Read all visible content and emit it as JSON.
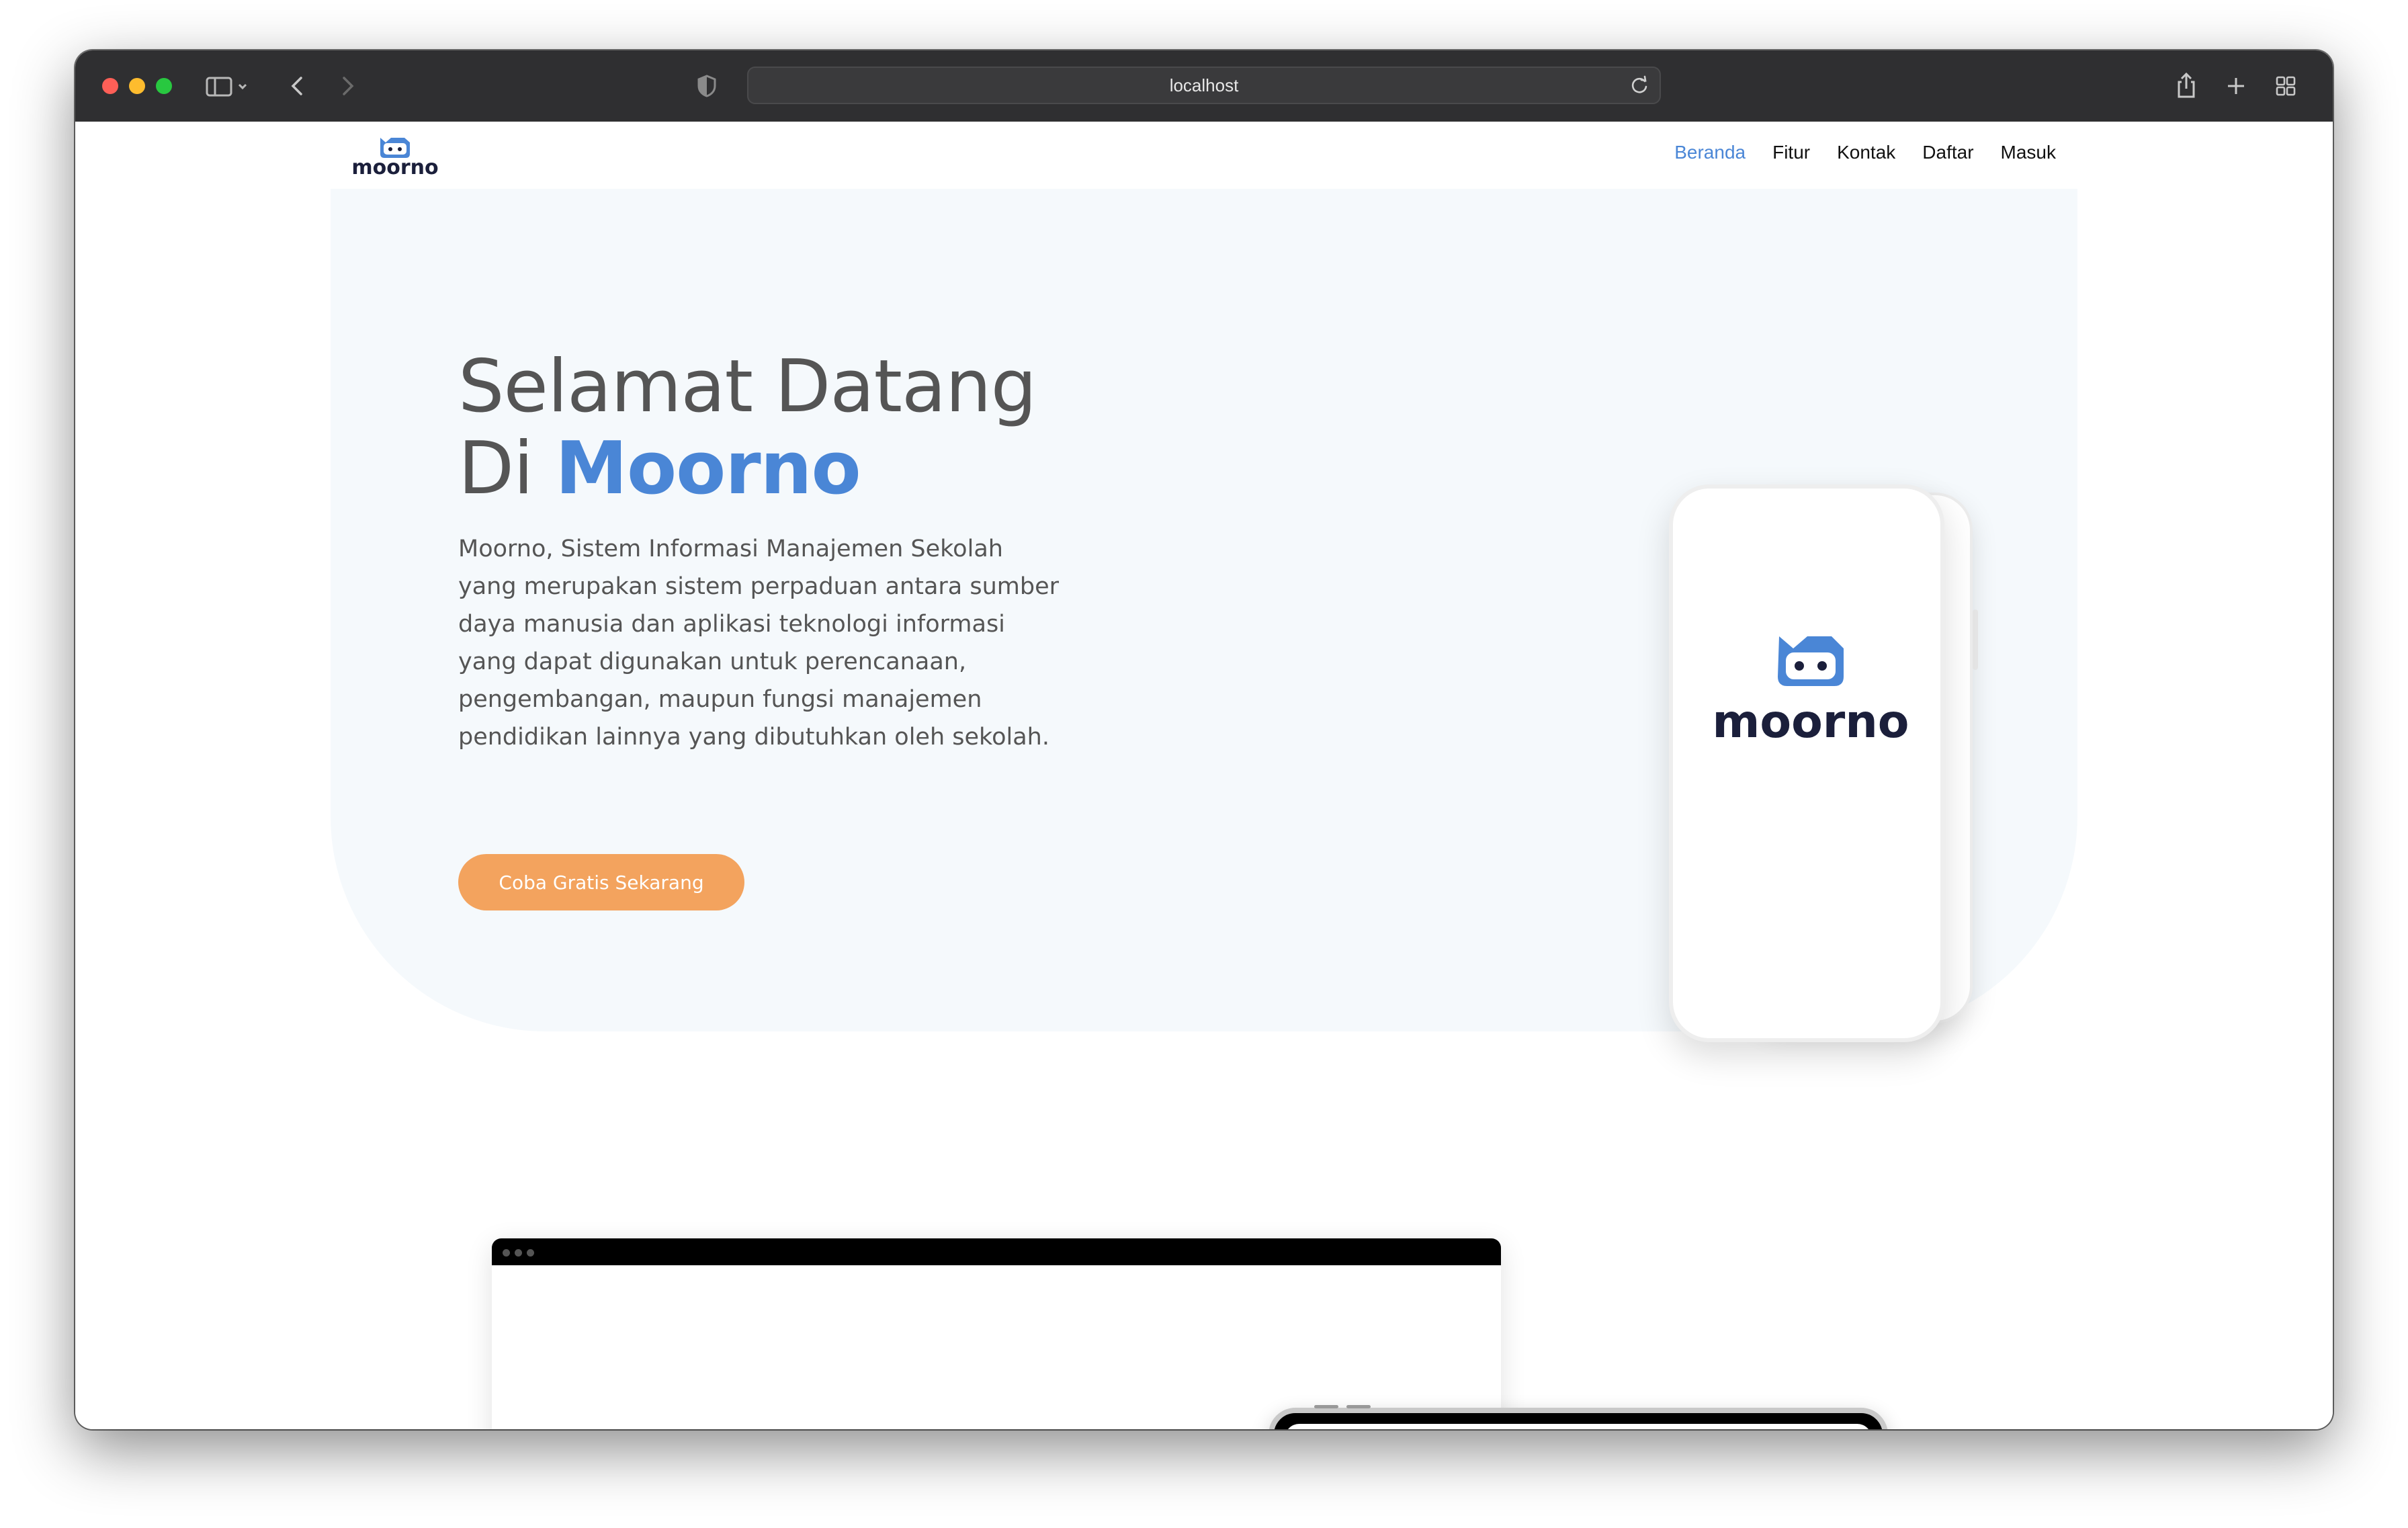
{
  "browser": {
    "url": "localhost"
  },
  "nav": {
    "items": [
      "Beranda",
      "Fitur",
      "Kontak",
      "Daftar",
      "Masuk"
    ],
    "active": "Beranda",
    "accent_color": "#4a86d6"
  },
  "hero": {
    "title_line1": "Selamat Datang",
    "title_prefix": "Di ",
    "title_brand": "Moorno",
    "description": "Moorno, Sistem Informasi Manajemen Sekolah yang merupakan sistem perpaduan antara sumber daya manusia dan aplikasi teknologi informasi yang dapat digunakan untuk perencanaan, pengembangan, maupun fungsi manajemen pendidikan lainnya yang dibutuhkan oleh sekolah.",
    "cta_label": "Coba Gratis Sekarang",
    "cta_color": "#f3a35e",
    "background_color": "#f5f9fc"
  },
  "logo": {
    "wordmark": "moorno",
    "icon": "moorno-cat-icon"
  }
}
